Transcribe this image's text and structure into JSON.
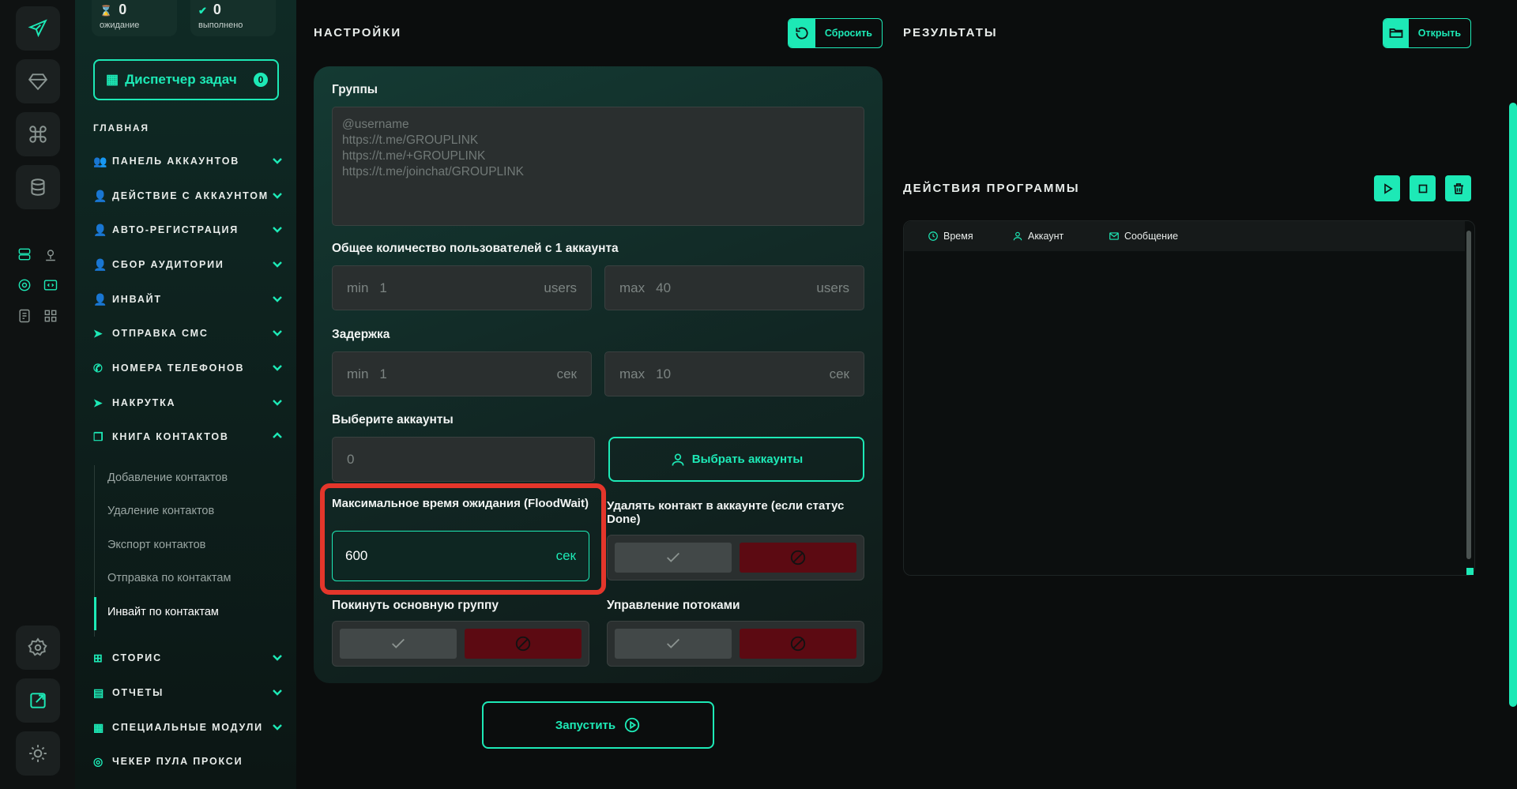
{
  "stats": {
    "pending": {
      "value": "0",
      "label": "ожидание"
    },
    "done": {
      "value": "0",
      "label": "выполнено"
    }
  },
  "task_manager": {
    "label": "Диспетчер задач",
    "badge": "0"
  },
  "sidebar": {
    "section_title": "ГЛАВНАЯ",
    "items": [
      {
        "label": "ПАНЕЛЬ АККАУНТОВ",
        "icon": "users-icon"
      },
      {
        "label": "ДЕЙСТВИЕ С АККАУНТОМ",
        "icon": "user-icon"
      },
      {
        "label": "АВТО-РЕГИСТРАЦИЯ",
        "icon": "user-plus-icon"
      },
      {
        "label": "СБОР АУДИТОРИИ",
        "icon": "user-list-icon"
      },
      {
        "label": "ИНВАЙТ",
        "icon": "user-add-icon"
      },
      {
        "label": "ОТПРАВКА СМС",
        "icon": "send-icon"
      },
      {
        "label": "НОМЕРА ТЕЛЕФОНОВ",
        "icon": "phone-icon"
      },
      {
        "label": "НАКРУТКА",
        "icon": "send-boost-icon"
      },
      {
        "label": "КНИГА КОНТАКТОВ",
        "icon": "book-icon"
      },
      {
        "label": "СТОРИС",
        "icon": "plus-square-icon"
      },
      {
        "label": "ОТЧЕТЫ",
        "icon": "report-icon"
      },
      {
        "label": "СПЕЦИАЛЬНЫЕ МОДУЛИ",
        "icon": "modules-icon"
      },
      {
        "label": "ЧЕКЕР ПУЛА ПРОКСИ",
        "icon": "proxy-icon"
      }
    ],
    "sub_items": [
      "Добавление контактов",
      "Удаление контактов",
      "Экспорт контактов",
      "Отправка по контактам",
      "Инвайт по контактам"
    ]
  },
  "settings": {
    "title": "НАСТРОЙКИ",
    "reset_label": "Сбросить",
    "groups_label": "Группы",
    "groups_placeholder": "@username\nhttps://t.me/GROUPLINK\nhttps://t.me/+GROUPLINK\nhttps://t.me/joinchat/GROUPLINK",
    "users_label": "Общее количество пользователей с 1 аккаунта",
    "users_min": {
      "prefix": "min",
      "value": "1",
      "suffix": "users"
    },
    "users_max": {
      "prefix": "max",
      "value": "40",
      "suffix": "users"
    },
    "delay_label": "Задержка",
    "delay_min": {
      "prefix": "min",
      "value": "1",
      "suffix": "сек"
    },
    "delay_max": {
      "prefix": "max",
      "value": "10",
      "suffix": "сек"
    },
    "accounts_label": "Выберите аккаунты",
    "accounts_value": "0",
    "select_accounts_label": "Выбрать аккаунты",
    "floodwait_label": "Максимальное время ожидания (FloodWait)",
    "floodwait_value": "600",
    "floodwait_suffix": "сек",
    "delete_contact_label": "Удалять контакт в аккаунте (если статус Done)",
    "leave_group_label": "Покинуть основную группу",
    "threads_label": "Управление потоками",
    "run_label": "Запустить"
  },
  "results": {
    "title": "РЕЗУЛЬТАТЫ",
    "open_label": "Открыть"
  },
  "program_actions": {
    "title": "ДЕЙСТВИЯ ПРОГРАММЫ",
    "columns": [
      "Время",
      "Аккаунт",
      "Сообщение"
    ]
  },
  "colors": {
    "accent": "#1de9b6",
    "danger": "#5c0a12",
    "highlight": "#e4362b"
  }
}
